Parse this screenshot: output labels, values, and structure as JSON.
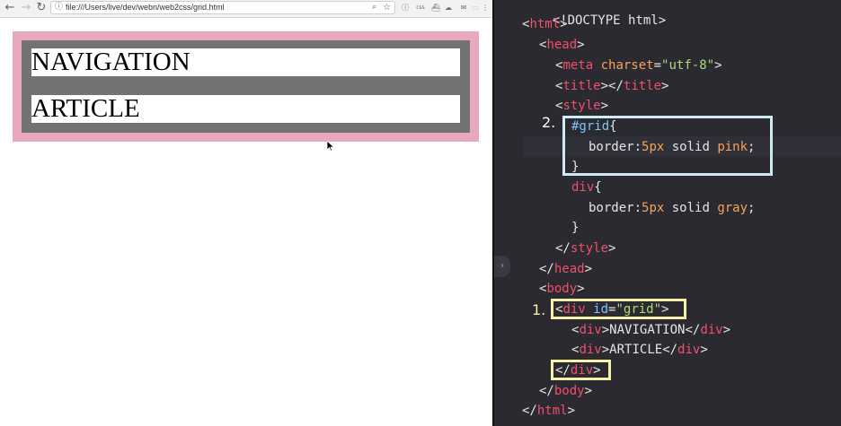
{
  "browser": {
    "nav": {
      "back_icon": "arrow-left",
      "forward_icon": "arrow-right",
      "reload_icon": "reload"
    },
    "address": {
      "url": "file:///Users/live/dev/webn/web2css/grid.html",
      "info_icon": "info-circle",
      "zoom_icon": "magnifier",
      "bookmark_icon": "star"
    },
    "extensions": [
      {
        "name": "info",
        "glyph": "ⓘ"
      },
      {
        "name": "css",
        "glyph": "css"
      },
      {
        "name": "docker",
        "glyph": "⛴"
      },
      {
        "name": "cloud",
        "glyph": "☁"
      },
      {
        "name": "mail",
        "glyph": "✉"
      },
      {
        "name": "reader",
        "glyph": "▭"
      },
      {
        "name": "menu",
        "glyph": "⋮"
      }
    ],
    "page": {
      "navigation_text": "NAVIGATION",
      "article_text": "ARTICLE"
    }
  },
  "editor": {
    "lines": {
      "l1": "<!DOCTYPE html>",
      "l2_tag": "html",
      "l3_tag": "head",
      "l4_tag": "meta",
      "l4_attr": "charset",
      "l4_val": "\"utf-8\"",
      "l5_tag": "title",
      "l6_tag": "style",
      "l7_sel": "#grid",
      "l8_prop": "border",
      "l8_num": "5px",
      "l8_mid": " solid ",
      "l8_color": "pink",
      "l10_sel": "div",
      "l11_prop": "border",
      "l11_num": "5px",
      "l11_mid": " solid ",
      "l11_color": "gray",
      "l15_tag": "body",
      "l16_tag": "div",
      "l16_attr": "id",
      "l16_val": "\"grid\"",
      "l17_text": "NAVIGATION",
      "l18_text": "ARTICLE"
    },
    "callouts": {
      "step1": "1.",
      "step2": "2."
    },
    "gutter_toggle_icon": "chevron-right"
  },
  "colors": {
    "grid_border": "#e9a9bd",
    "div_border": "#737373",
    "editor_bg": "#2a2a30",
    "tag": "#f0506e",
    "attr": "#f5a35c",
    "string": "#a9dc76",
    "callout_blue": "#cfe9f6",
    "callout_yellow": "#f6f0a8"
  }
}
